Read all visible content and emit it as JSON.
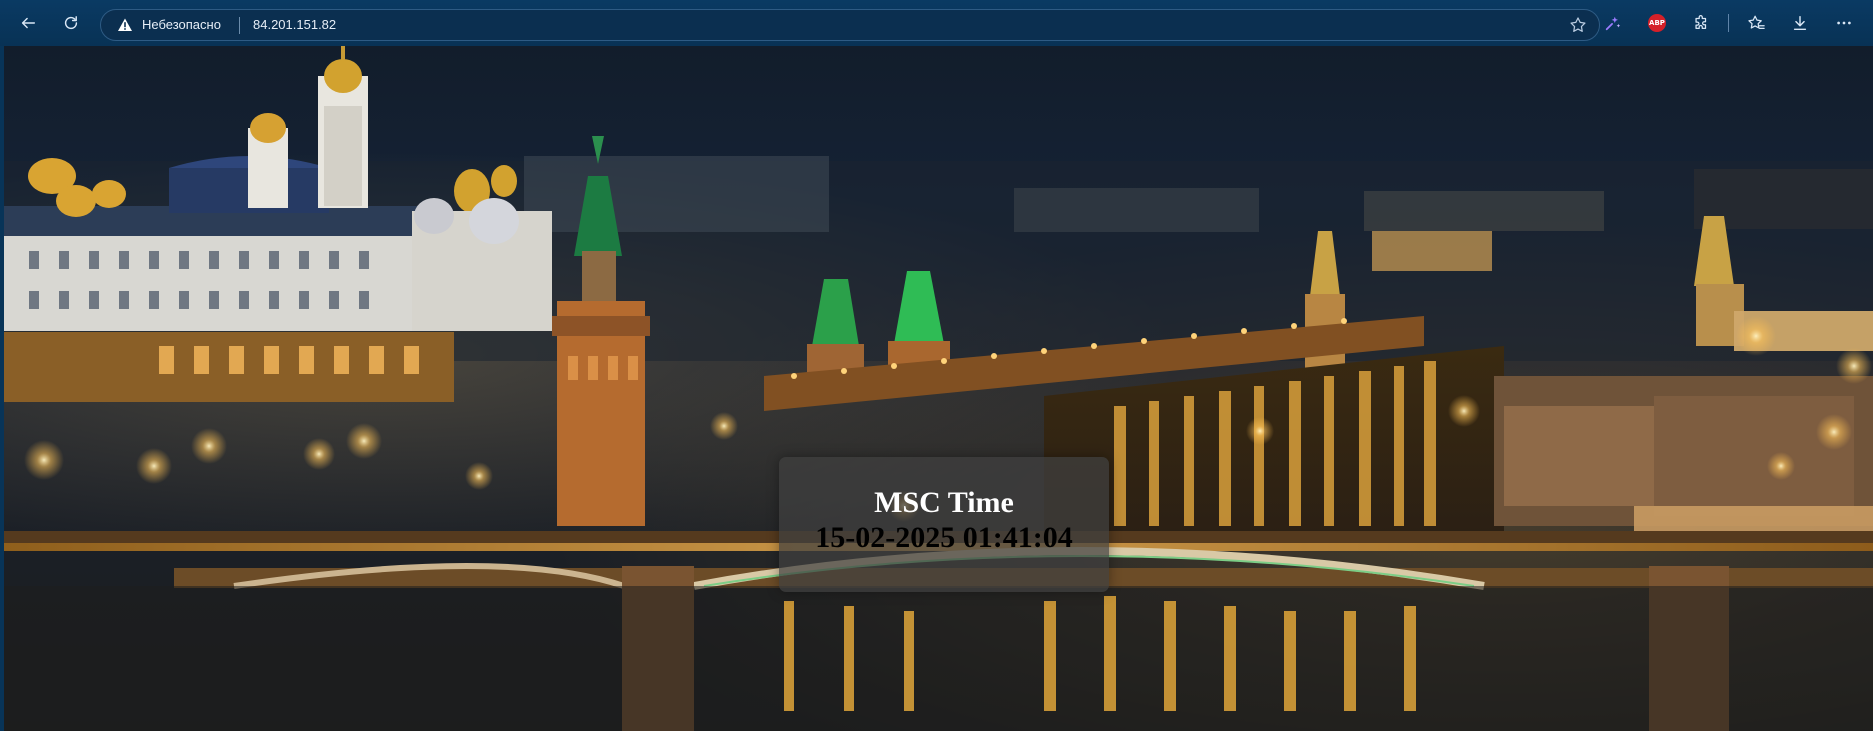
{
  "browser": {
    "security_label": "Небезопасно",
    "url": "84.201.151.82",
    "icons": [
      "back-arrow-icon",
      "reload-icon",
      "warning-icon",
      "favorite-star-icon",
      "extension-icon",
      "adblock-plus-icon",
      "extensions-puzzle-icon",
      "favorites-icon",
      "downloads-icon",
      "more-menu-icon"
    ],
    "abp_text": "ABP",
    "colors": {
      "toolbar": "#083458",
      "address_bar": "#0b2f50",
      "abp_badge": "#d52029"
    }
  },
  "page": {
    "background_image": "night view of Moscow Kremlin with illuminated bridge and river",
    "time_panel": {
      "title": "MSC Time",
      "datetime": "15-02-2025 01:41:04"
    },
    "colors": {
      "panel": "rgba(64,64,64,0.72)",
      "title_text": "#ffffff",
      "datetime_text": "#000000"
    }
  }
}
